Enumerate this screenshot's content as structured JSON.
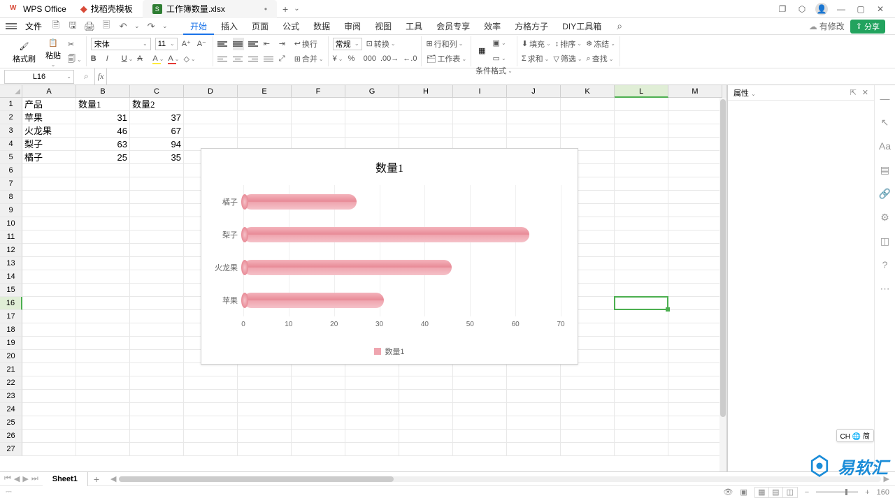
{
  "title_bar": {
    "wps_tab": "WPS Office",
    "find_tab": "找稻壳模板",
    "doc_tab": "工作簿数量.xlsx"
  },
  "menu": {
    "file": "文件",
    "tabs": [
      "开始",
      "插入",
      "页面",
      "公式",
      "数据",
      "审阅",
      "视图",
      "工具",
      "会员专享",
      "效率",
      "方格方子",
      "DIY工具箱"
    ],
    "active_tab": 0,
    "has_modification": "有修改",
    "share": "分享"
  },
  "ribbon": {
    "format_painter": "格式刷",
    "paste": "粘贴",
    "font_name": "宋体",
    "font_size": "11",
    "wrap": "换行",
    "merge": "合并",
    "number_fmt": "常规",
    "cvt": "转换",
    "rowcol": "行和列",
    "worksheet": "工作表",
    "cond": "条件格式",
    "fill": "填充",
    "sort": "排序",
    "freeze": "冻结",
    "sum": "求和",
    "filter": "筛选",
    "find": "查找"
  },
  "formula_bar": {
    "name_box": "L16",
    "formula": ""
  },
  "right_pane": {
    "title": "属性"
  },
  "columns": [
    "A",
    "B",
    "C",
    "D",
    "E",
    "F",
    "G",
    "H",
    "I",
    "J",
    "K",
    "L",
    "M"
  ],
  "selected_col_index": 11,
  "selected_row": 16,
  "rows": 27,
  "table": {
    "headers": [
      "产品",
      "数量1",
      "数量2"
    ],
    "rows": [
      {
        "p": "苹果",
        "q1": 31,
        "q2": 37
      },
      {
        "p": "火龙果",
        "q1": 46,
        "q2": 67
      },
      {
        "p": "梨子",
        "q1": 63,
        "q2": 94
      },
      {
        "p": "橘子",
        "q1": 25,
        "q2": 35
      }
    ]
  },
  "chart_data": {
    "type": "bar",
    "orientation": "horizontal",
    "title": "数量1",
    "categories": [
      "橘子",
      "梨子",
      "火龙果",
      "苹果"
    ],
    "values": [
      25,
      63,
      46,
      31
    ],
    "xlim": [
      0,
      70
    ],
    "ticks": [
      0,
      10,
      20,
      30,
      40,
      50,
      60,
      70
    ],
    "legend": [
      "数量1"
    ],
    "series_color": "#efa5af"
  },
  "sheet_tabs": {
    "active": "Sheet1"
  },
  "status": {
    "zoom": "160",
    "ime": "CH 🌐 简"
  },
  "watermark": "易软汇"
}
